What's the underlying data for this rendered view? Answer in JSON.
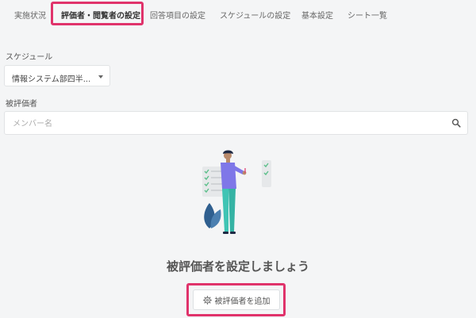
{
  "tabs": [
    {
      "label": "実施状況"
    },
    {
      "label": "評価者・閲覧者の設定",
      "active": true
    },
    {
      "label": "回答項目の設定"
    },
    {
      "label": "スケジュールの設定"
    },
    {
      "label": "基本設定"
    },
    {
      "label": "シート一覧"
    }
  ],
  "schedule": {
    "label": "スケジュール",
    "selected": "情報システム部四半..."
  },
  "evaluatee": {
    "label": "被評価者",
    "search_placeholder": "メンバー名"
  },
  "empty_state": {
    "heading": "被評価者を設定しましょう",
    "add_button": "被評価者を追加"
  },
  "colors": {
    "highlight": "#e0336b",
    "background": "#f4f5f6"
  },
  "icons": {
    "search": "search-icon",
    "gear": "gear-icon",
    "dropdown": "caret-down-icon"
  }
}
